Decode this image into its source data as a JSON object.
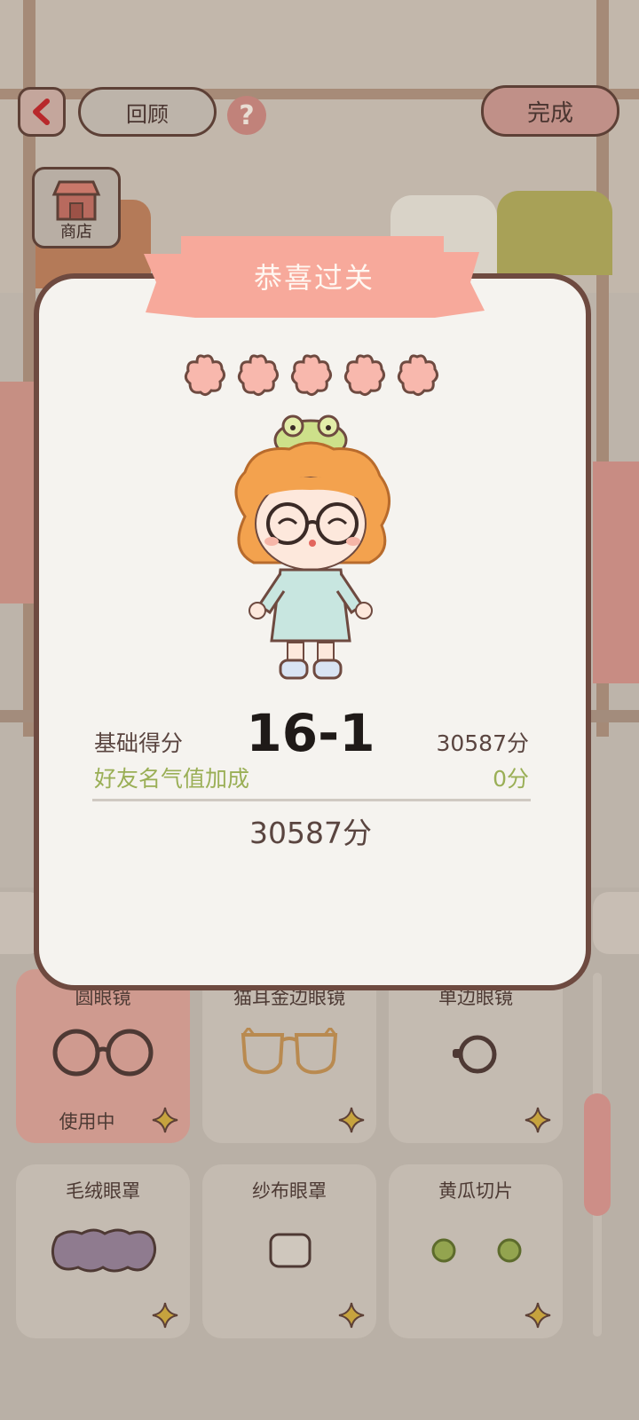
{
  "header": {
    "review_label": "回顾",
    "help_symbol": "?",
    "done_label": "完成",
    "shop_label": "商店"
  },
  "modal": {
    "title": "恭喜过关",
    "stars_earned": 5,
    "stars_total": 5,
    "level": "16-1",
    "base_score_label": "基础得分",
    "base_score_value": "30587分",
    "bonus_label": "好友名气值加成",
    "bonus_value": "0分",
    "total_value": "30587分"
  },
  "items": [
    {
      "label": "圆眼镜",
      "status": "使用中",
      "selected": true,
      "icon": "round-glasses-icon"
    },
    {
      "label": "猫耳金边眼镜",
      "status": "",
      "selected": false,
      "icon": "cat-ear-glasses-icon"
    },
    {
      "label": "单边眼镜",
      "status": "",
      "selected": false,
      "icon": "monocle-icon"
    },
    {
      "label": "毛绒眼罩",
      "status": "",
      "selected": false,
      "icon": "plush-eye-mask-icon"
    },
    {
      "label": "纱布眼罩",
      "status": "",
      "selected": false,
      "icon": "gauze-eye-patch-icon"
    },
    {
      "label": "黄瓜切片",
      "status": "",
      "selected": false,
      "icon": "cucumber-slices-icon"
    }
  ],
  "colors": {
    "accent_pink": "#f7a99b",
    "bonus_green": "#9aaf56",
    "frame_brown": "#6e4a40",
    "modal_bg": "#f5f3ef"
  }
}
